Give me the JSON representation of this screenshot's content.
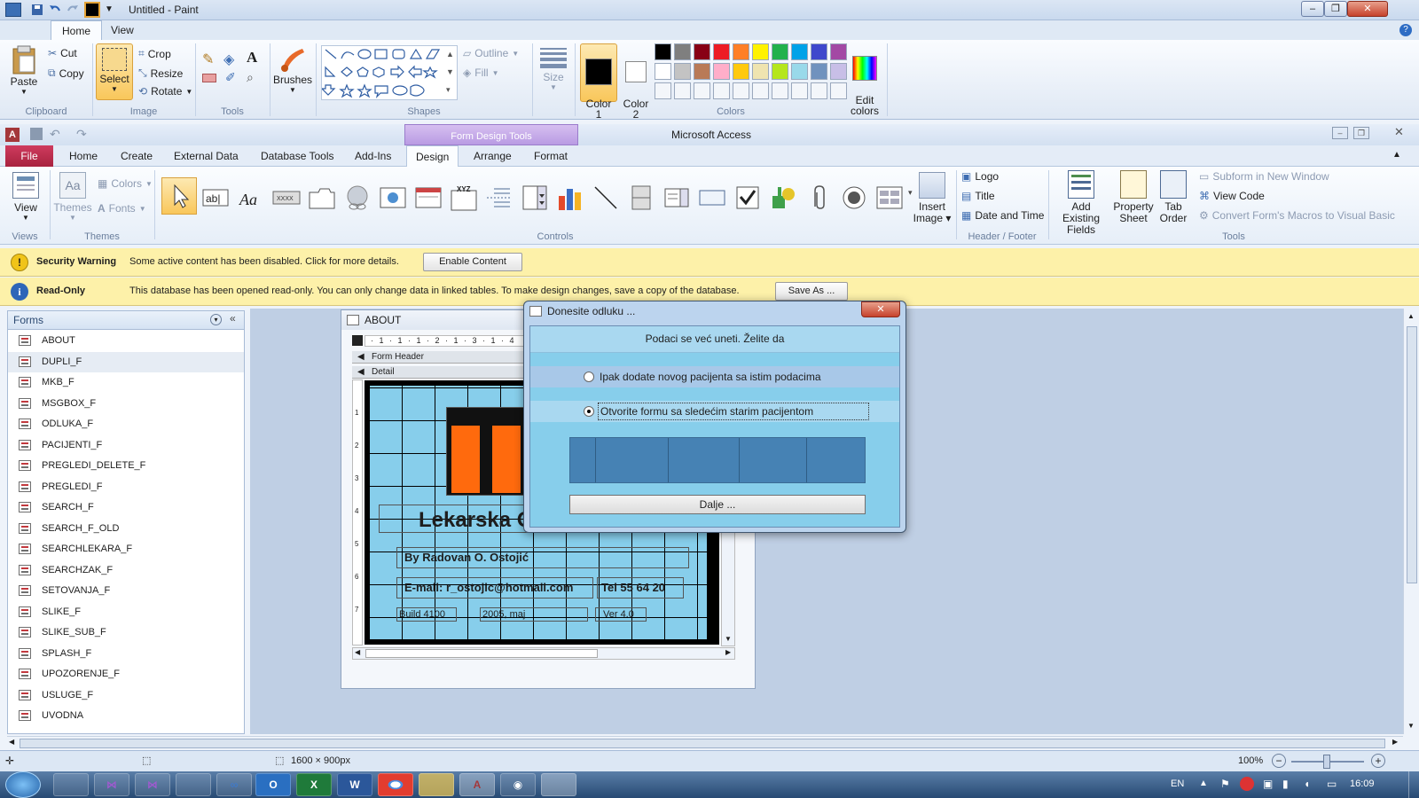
{
  "paint": {
    "title": "Untitled - Paint",
    "tabs": [
      "Home",
      "View"
    ],
    "clipboard": {
      "paste": "Paste",
      "cut": "Cut",
      "copy": "Copy",
      "group": "Clipboard"
    },
    "image": {
      "select": "Select",
      "crop": "Crop",
      "resize": "Resize",
      "rotate": "Rotate",
      "group": "Image"
    },
    "tools_group": "Tools",
    "brushes": "Brushes",
    "shapes": {
      "outline": "Outline",
      "fill": "Fill",
      "group": "Shapes"
    },
    "size": "Size",
    "color1": "Color\n1",
    "color2": "Color\n2",
    "colors_group": "Colors",
    "edit_colors": "Edit\ncolors",
    "palette_row1": [
      "#000000",
      "#7f7f7f",
      "#880015",
      "#ed1c24",
      "#ff7f27",
      "#fff200",
      "#22b14c",
      "#00a2e8",
      "#3f48cc",
      "#a349a4"
    ],
    "palette_row2": [
      "#ffffff",
      "#c3c3c3",
      "#b97a57",
      "#ffaec9",
      "#ffc90e",
      "#efe4b0",
      "#b5e61d",
      "#99d9ea",
      "#7092be",
      "#c8bfe7"
    ]
  },
  "access": {
    "title": "Microsoft Access",
    "contextual": "Form Design Tools",
    "tabs": [
      "File",
      "Home",
      "Create",
      "External Data",
      "Database Tools",
      "Add-Ins",
      "Design",
      "Arrange",
      "Format"
    ],
    "views": {
      "view": "View",
      "group": "Views"
    },
    "themes": {
      "themes": "Themes",
      "colors": "Colors",
      "fonts": "Fonts",
      "group": "Themes"
    },
    "controls_group": "Controls",
    "insert_image": "Insert Image",
    "header_footer": {
      "logo": "Logo",
      "title": "Title",
      "datetime": "Date and Time",
      "group": "Header / Footer"
    },
    "tools": {
      "add_fields": "Add Existing Fields",
      "property_sheet": "Property Sheet",
      "tab_order": "Tab Order",
      "subform": "Subform in New Window",
      "view_code": "View Code",
      "convert": "Convert Form's Macros to Visual Basic",
      "group": "Tools"
    },
    "security": {
      "title": "Security Warning",
      "text": "Some active content has been disabled. Click for more details.",
      "button": "Enable Content"
    },
    "readonly": {
      "title": "Read-Only",
      "text": "This database has been opened read-only. You can only change data in linked tables. To make design changes, save a copy of the database.",
      "button": "Save As ..."
    },
    "nav": {
      "title": "Forms",
      "items": [
        "ABOUT",
        "DUPLI_F",
        "MKB_F",
        "MSGBOX_F",
        "ODLUKA_F",
        "PACIJENTI_F",
        "PREGLEDI_DELETE_F",
        "PREGLEDI_F",
        "SEARCH_F",
        "SEARCH_F_OLD",
        "SEARCHLEKARA_F",
        "SEARCHZAK_F",
        "SETOVANJA_F",
        "SLIKE_F",
        "SLIKE_SUB_F",
        "SPLASH_F",
        "UPOZORENJE_F",
        "USLUGE_F",
        "UVODNA"
      ]
    },
    "form_about": {
      "title": "ABOUT",
      "form_header": "Form Header",
      "detail": "Detail",
      "app_name": "Lekarska Ordinacija",
      "author": "By Radovan O. Ostojić",
      "email": "E-mail: r_ostojic@hotmail.com",
      "tel": "Tel 55 64 20",
      "build": "Build 4100",
      "date": "2005, maj",
      "ver": "Ver 4.0",
      "ruler": "· 1 · 1 · 1 · 2 · 1 · 3 · 1 · 4",
      "vruler": [
        "1",
        "2",
        "3",
        "4",
        "5",
        "6",
        "7"
      ]
    },
    "dialog": {
      "title": "Donesite odluku ...",
      "prompt": "Podaci se već uneti. Želite da",
      "option1": "Ipak dodate novog pacijenta sa istim podacima",
      "option2": "Otvorite formu sa sledećim starim pacijentom",
      "selected": 2,
      "button": "Dalje ..."
    }
  },
  "status": {
    "dimensions": "1600 × 900px",
    "zoom": "100%"
  },
  "taskbar": {
    "lang": "EN",
    "time": "16:09"
  }
}
